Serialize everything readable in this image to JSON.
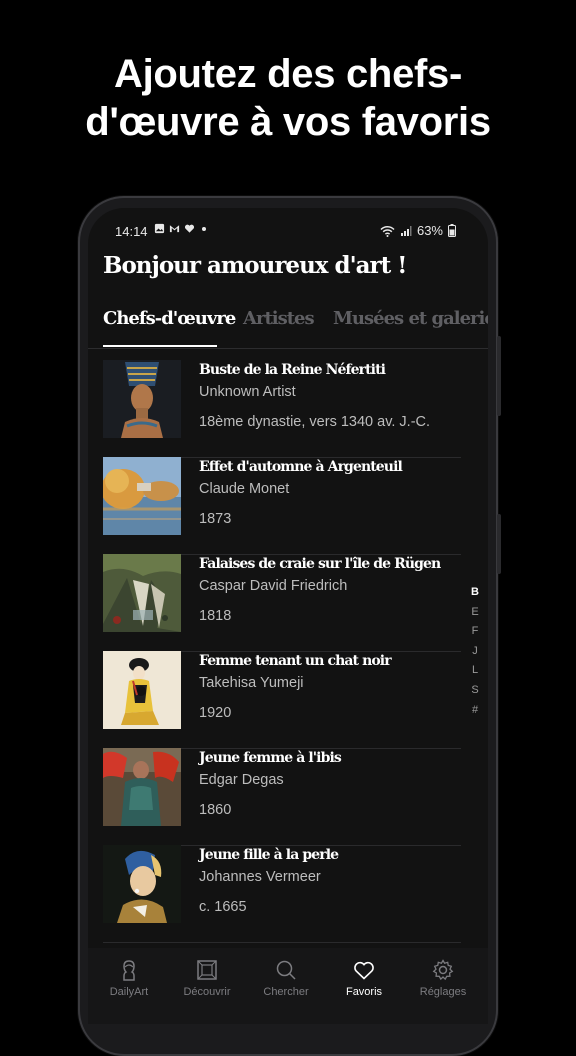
{
  "headline": {
    "line1": "Ajoutez des chefs-",
    "line2": "d'œuvre à vos favoris"
  },
  "status_bar": {
    "time": "14:14",
    "battery": "63%"
  },
  "greeting": "Bonjour amoureux d'art !",
  "tabs": [
    {
      "label": "Chefs-d'œuvre",
      "active": true
    },
    {
      "label": "Artistes",
      "active": false
    },
    {
      "label": "Musées et galeries",
      "active": false
    }
  ],
  "artworks": [
    {
      "title": "Buste de la Reine Néfertiti",
      "artist": "Unknown Artist",
      "date": "18ème dynastie, vers 1340 av. J.-C."
    },
    {
      "title": "Effet d'automne à Argenteuil",
      "artist": "Claude Monet",
      "date": "1873"
    },
    {
      "title": "Falaises de craie sur l'île de Rügen",
      "artist": "Caspar David Friedrich",
      "date": "1818"
    },
    {
      "title": "Femme tenant un chat noir",
      "artist": "Takehisa Yumeji",
      "date": "1920"
    },
    {
      "title": "Jeune femme à l'ibis",
      "artist": "Edgar Degas",
      "date": "1860"
    },
    {
      "title": "Jeune fille à la perle",
      "artist": "Johannes Vermeer",
      "date": "c. 1665"
    }
  ],
  "alpha_index": [
    "B",
    "E",
    "F",
    "J",
    "L",
    "S",
    "#"
  ],
  "bottom_nav": [
    {
      "label": "DailyArt",
      "icon": "bust-icon",
      "active": false
    },
    {
      "label": "Découvrir",
      "icon": "frame-icon",
      "active": false
    },
    {
      "label": "Chercher",
      "icon": "search-icon",
      "active": false
    },
    {
      "label": "Favoris",
      "icon": "heart-icon",
      "active": true
    },
    {
      "label": "Réglages",
      "icon": "gear-icon",
      "active": false
    }
  ]
}
